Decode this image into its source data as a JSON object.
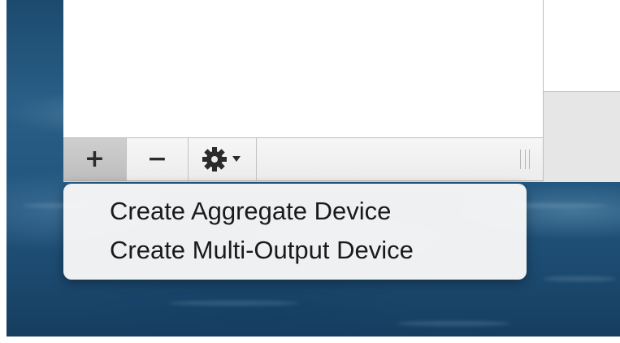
{
  "toolbar": {
    "add_glyph": "+",
    "remove_glyph": "−",
    "action_icon": "gear-icon",
    "action_chevron_icon": "chevron-down-icon"
  },
  "menu": {
    "items": [
      {
        "label": "Create Aggregate Device"
      },
      {
        "label": "Create Multi-Output Device"
      }
    ]
  },
  "colors": {
    "wallpaper": "#24577f",
    "menu_background": "#f6f6f6",
    "add_button_pressed": "#c6c6c6",
    "text": "#1a1a1a"
  }
}
